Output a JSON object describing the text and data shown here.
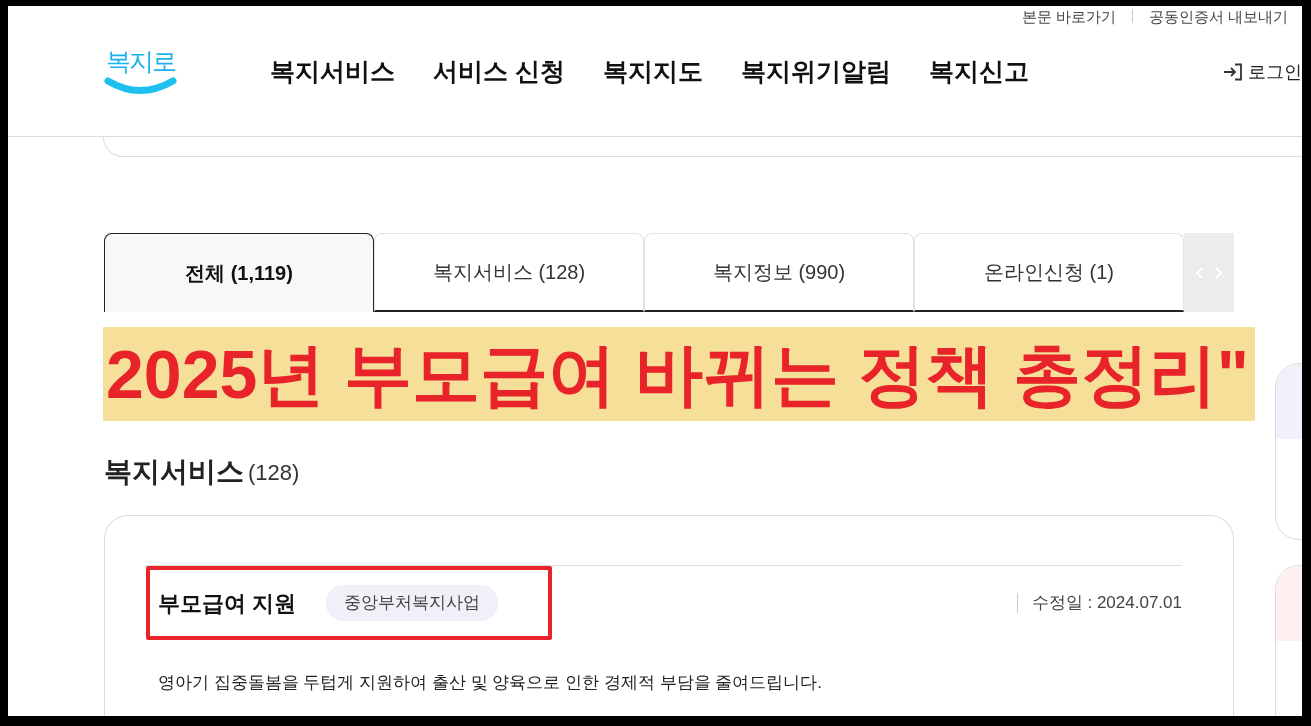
{
  "utility_links": [
    {
      "label": "본문 바로가기"
    },
    {
      "label": "공동인증서 내보내기"
    }
  ],
  "header": {
    "logo": "복지로",
    "nav": [
      {
        "label": "복지서비스"
      },
      {
        "label": "서비스 신청"
      },
      {
        "label": "복지지도"
      },
      {
        "label": "복지위기알림"
      },
      {
        "label": "복지신고"
      }
    ],
    "login": "로그인"
  },
  "tabs": [
    {
      "label": "전체 (1,119)",
      "selected": true
    },
    {
      "label": "복지서비스 (128)",
      "selected": false
    },
    {
      "label": "복지정보 (990)",
      "selected": false
    },
    {
      "label": "온라인신청 (1)",
      "selected": false
    }
  ],
  "banner": {
    "text": "2025년 부모급여 바뀌는 정책 총정리\""
  },
  "section": {
    "title": "복지서비스",
    "count": "(128)"
  },
  "results": [
    {
      "title": "부모급여 지원",
      "tag": "중앙부처복지사업",
      "modified": "수정일 : 2024.07.01",
      "description": "영아기 집중돌봄을 두텁게 지원하여 출산 및 양육으로 인한 경제적 부담을 줄여드립니다.",
      "highlighted": true
    }
  ],
  "side_cards": [
    {
      "color": "#f3f0fb"
    },
    {
      "color": "#fdf0ef"
    }
  ]
}
